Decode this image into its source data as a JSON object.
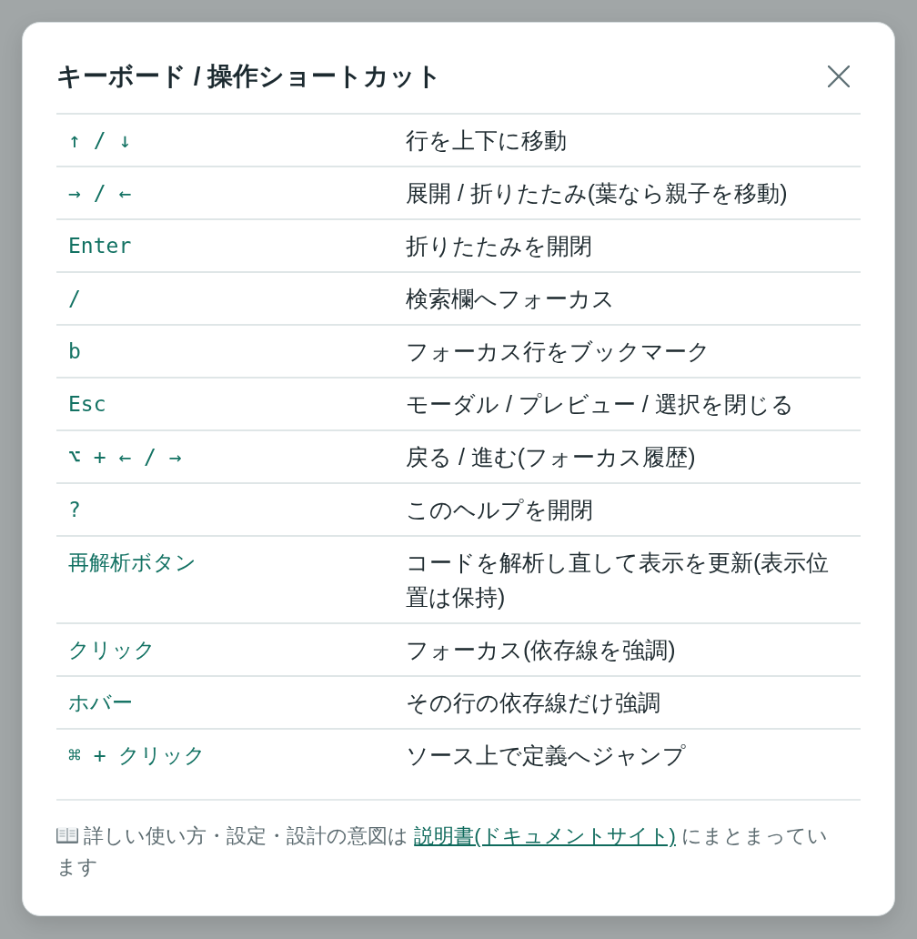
{
  "dialog": {
    "title": "キーボード / 操作ショートカット"
  },
  "shortcuts": [
    {
      "key": "↑ / ↓",
      "action": "行を上下に移動"
    },
    {
      "key": "→ / ←",
      "action": "展開 / 折りたたみ(葉なら親子を移動)"
    },
    {
      "key": "Enter",
      "action": "折りたたみを開閉"
    },
    {
      "key": "/",
      "action": "検索欄へフォーカス"
    },
    {
      "key": "b",
      "action": "フォーカス行をブックマーク"
    },
    {
      "key": "Esc",
      "action": "モーダル / プレビュー / 選択を閉じる"
    },
    {
      "key": "⌥ + ← / →",
      "action": "戻る / 進む(フォーカス履歴)"
    },
    {
      "key": "?",
      "action": "このヘルプを開閉"
    },
    {
      "key": "再解析ボタン",
      "action": "コードを解析し直して表示を更新(表示位置は保持)"
    },
    {
      "key": "クリック",
      "action": "フォーカス(依存線を強調)"
    },
    {
      "key": "ホバー",
      "action": "その行の依存線だけ強調"
    },
    {
      "key": "⌘ + クリック",
      "action": "ソース上で定義へジャンプ"
    }
  ],
  "footer": {
    "text_before": "詳しい使い方・設定・設計の意図は ",
    "link": "説明書(ドキュメントサイト)",
    "text_after": " にまとまっています"
  }
}
